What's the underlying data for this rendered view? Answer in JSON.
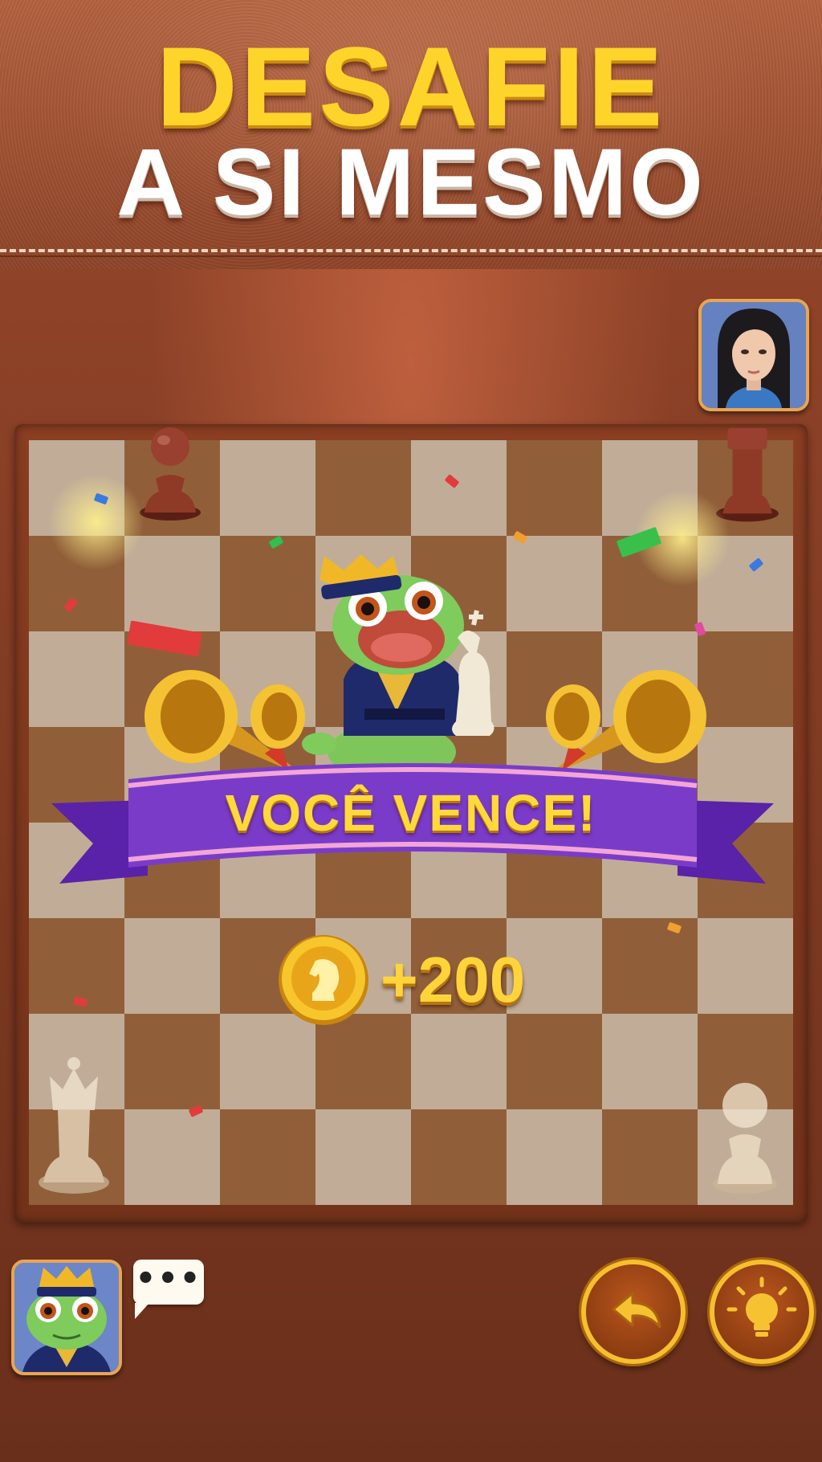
{
  "header": {
    "title_line1": "DESAFIE",
    "title_line2": "A SI MESMO"
  },
  "result": {
    "banner_text": "VOCÊ VENCE!",
    "reward_text": "+200",
    "reward_icon": "gold-knight-coin-icon"
  },
  "players": {
    "opponent_avatar": "woman-avatar",
    "player_avatar": "frog-king-avatar"
  },
  "controls": {
    "chat_icon": "chat-bubble-icon",
    "undo_icon": "undo-arrow-icon",
    "hint_icon": "lightbulb-icon"
  },
  "colors": {
    "title_yellow": "#ffd42a",
    "banner_purple": "#7a3cc8",
    "button_gold": "#f6bf2e",
    "light_square": "#d7c3ab",
    "dark_square": "#9f6a40"
  }
}
